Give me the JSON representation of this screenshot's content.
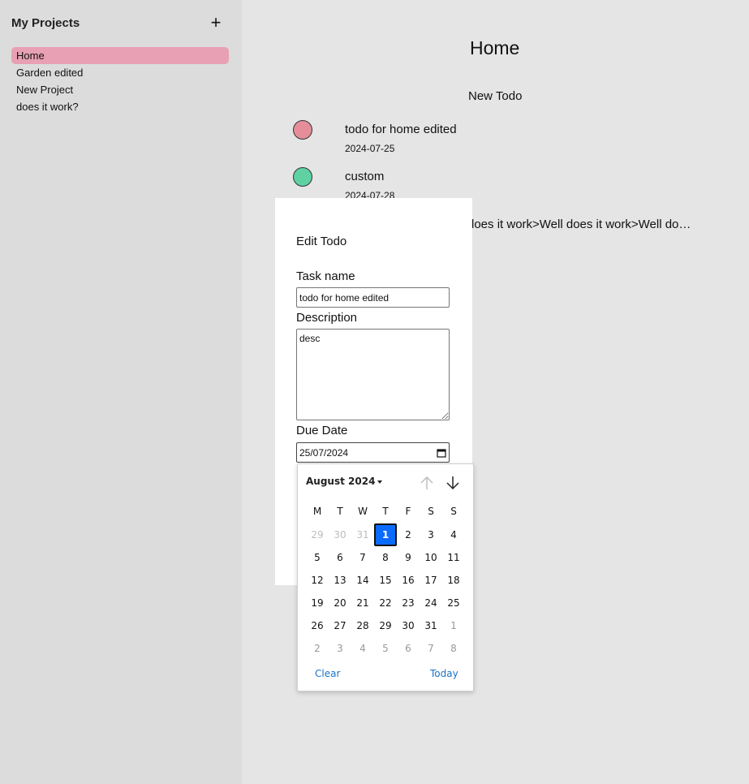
{
  "sidebar": {
    "title": "My Projects",
    "add_label": "+",
    "projects": [
      {
        "label": "Home",
        "active": true
      },
      {
        "label": "Garden edited",
        "active": false
      },
      {
        "label": "New Project",
        "active": false
      },
      {
        "label": "does it work?",
        "active": false
      }
    ]
  },
  "main": {
    "title": "Home",
    "new_todo_label": "New Todo",
    "todos": [
      {
        "name": "todo for home edited",
        "date": "2024-07-25",
        "color": "#e58e9a"
      },
      {
        "name": "custom",
        "date": "2024-07-28",
        "color": "#5fd1a3"
      }
    ],
    "overflow_text": "does it work>Well does it work>Well does it work>Well does it work"
  },
  "modal": {
    "title": "Edit Todo",
    "task_label": "Task name",
    "task_value": "todo for home edited",
    "desc_label": "Description",
    "desc_value": "desc",
    "due_label": "Due Date",
    "due_value": "25/07/2024"
  },
  "picker": {
    "month_label": "August 2024",
    "weekdays": [
      "M",
      "T",
      "W",
      "T",
      "F",
      "S",
      "S"
    ],
    "weeks": [
      [
        "29",
        "30",
        "31",
        "1",
        "2",
        "3",
        "4"
      ],
      [
        "5",
        "6",
        "7",
        "8",
        "9",
        "10",
        "11"
      ],
      [
        "12",
        "13",
        "14",
        "15",
        "16",
        "17",
        "18"
      ],
      [
        "19",
        "20",
        "21",
        "22",
        "23",
        "24",
        "25"
      ],
      [
        "26",
        "27",
        "28",
        "29",
        "30",
        "31",
        "1"
      ],
      [
        "2",
        "3",
        "4",
        "5",
        "6",
        "7",
        "8"
      ]
    ],
    "clear_label": "Clear",
    "today_label": "Today"
  }
}
